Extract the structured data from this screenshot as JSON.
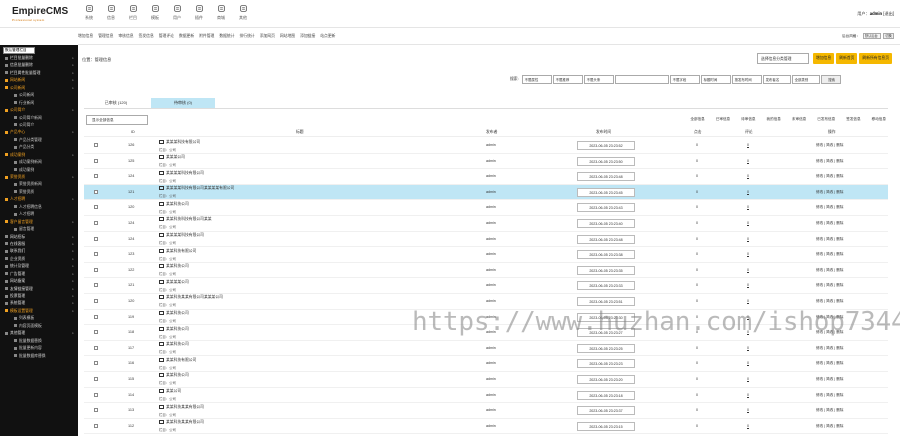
{
  "app": {
    "logo": "EmpireCMS",
    "logo_sub": "Professional system"
  },
  "topnav": [
    "系统",
    "信息",
    "栏目",
    "模板",
    "用户",
    "插件",
    "商城",
    "其他"
  ],
  "user": {
    "label": "用户：",
    "name": "admin",
    "logout": "[退出]"
  },
  "subnav": [
    "增加信息",
    "管理信息",
    "审核信息",
    "签发信息",
    "管理评论",
    "数据更新",
    "附件管理",
    "数据统计",
    "排行统计",
    "添加网页",
    "网站地图",
    "添加链接",
    "站点更新"
  ],
  "skin": {
    "label": "后台风格：",
    "select": "默认后台",
    "button": "切换"
  },
  "sidebar": {
    "select": "默认管理栏目",
    "items": [
      {
        "label": "栏目批量删除",
        "kind": "top"
      },
      {
        "label": "信息批量删除",
        "kind": "top"
      },
      {
        "label": "栏目属性批量管理",
        "kind": "top"
      },
      {
        "label": "网站新闻",
        "kind": "grp"
      },
      {
        "label": "公司新闻",
        "kind": "grp"
      },
      {
        "label": "公司新闻",
        "kind": "sub"
      },
      {
        "label": "行业新闻",
        "kind": "sub"
      },
      {
        "label": "公司简介",
        "kind": "grp"
      },
      {
        "label": "公司简介新闻",
        "kind": "sub"
      },
      {
        "label": "公司简介",
        "kind": "sub"
      },
      {
        "label": "产品中心",
        "kind": "grp"
      },
      {
        "label": "产品分类管理",
        "kind": "sub"
      },
      {
        "label": "产品分类",
        "kind": "sub"
      },
      {
        "label": "成功案例",
        "kind": "grp"
      },
      {
        "label": "成功案例新闻",
        "kind": "sub"
      },
      {
        "label": "成功案例",
        "kind": "sub"
      },
      {
        "label": "荣誉资质",
        "kind": "grp"
      },
      {
        "label": "荣誉资质新闻",
        "kind": "sub"
      },
      {
        "label": "荣誉资质",
        "kind": "sub"
      },
      {
        "label": "人才招聘",
        "kind": "grp"
      },
      {
        "label": "人才招聘信息",
        "kind": "sub"
      },
      {
        "label": "人才招聘",
        "kind": "sub"
      },
      {
        "label": "客户留言管理",
        "kind": "grp"
      },
      {
        "label": "留言管理",
        "kind": "sub"
      },
      {
        "label": "网站招标",
        "kind": "top"
      },
      {
        "label": "在线客服",
        "kind": "top"
      },
      {
        "label": "联系我们",
        "kind": "top"
      },
      {
        "label": "企业资质",
        "kind": "top"
      },
      {
        "label": "统计及管理",
        "kind": "top"
      },
      {
        "label": "广告管理",
        "kind": "top"
      },
      {
        "label": "网站备案",
        "kind": "top"
      },
      {
        "label": "友情链接管理",
        "kind": "top"
      },
      {
        "label": "投票管理",
        "kind": "top"
      },
      {
        "label": "系统管理",
        "kind": "top"
      },
      {
        "label": "模板设置管理",
        "kind": "grp"
      },
      {
        "label": "列表模板",
        "kind": "sub"
      },
      {
        "label": "内容页面模板",
        "kind": "sub"
      },
      {
        "label": "其他管理",
        "kind": "top"
      },
      {
        "label": "批量数据替换",
        "kind": "sub"
      },
      {
        "label": "批量更新内容",
        "kind": "sub"
      },
      {
        "label": "批量数据库替换",
        "kind": "sub"
      }
    ]
  },
  "location": {
    "label": "位置：",
    "value": "管理信息"
  },
  "top_actions": {
    "select": "选择信息分类管理",
    "buttons": [
      "增加信息",
      "刷新首页",
      "刷新所有信息页"
    ]
  },
  "search": {
    "label": "搜索:",
    "selects": [
      "不限属性",
      "不限推荐",
      "不限头条",
      "不限字段",
      "标题时间",
      "按发布时间",
      "发布者名",
      "全部类别"
    ],
    "button": "搜索"
  },
  "tabs": [
    {
      "label": "已审核 (120)",
      "active": false
    },
    {
      "label": "待审核 (0)",
      "active": true
    }
  ],
  "toolbar": {
    "select": "显示全部信息",
    "links": [
      "全部信息",
      "已审信息",
      "待审信息",
      "我的信息",
      "未审信息",
      "已发布信息",
      "签发信息",
      "移动信息"
    ]
  },
  "columns": {
    "id": "ID",
    "title": "标题",
    "publisher": "发布者",
    "date": "发布时间",
    "clicks": "点击",
    "comments": "评论",
    "ops": "操作"
  },
  "rows": [
    {
      "id": "126",
      "title": "某某某科技有限公司",
      "cat": "栏目：公司",
      "pub": "admin",
      "date": "2023-06-05 23:23:52",
      "c": "0",
      "m": "0"
    },
    {
      "id": "125",
      "title": "某某某公司",
      "cat": "栏目：公司",
      "pub": "admin",
      "date": "2023-06-05 23:23:50",
      "c": "0",
      "m": "0"
    },
    {
      "id": "124",
      "title": "某某某某科技有限公司",
      "cat": "栏目：公司",
      "pub": "admin",
      "date": "2023-06-05 23:23:48",
      "c": "0",
      "m": "0"
    },
    {
      "id": "121",
      "title": "某某某某科技有限公司某某某某有限公司",
      "cat": "栏目：公司",
      "pub": "admin",
      "date": "2023-06-05 23:23:45",
      "c": "0",
      "m": "0"
    },
    {
      "id": "120",
      "title": "某某科技公司",
      "cat": "栏目：公司",
      "pub": "admin",
      "date": "2023-06-05 23:23:43",
      "c": "0",
      "m": "0"
    },
    {
      "id": "124",
      "title": "某某科技科技有限公司某某",
      "cat": "栏目：公司",
      "pub": "admin",
      "date": "2023-06-05 23:23:40",
      "c": "0",
      "m": "0"
    },
    {
      "id": "124",
      "title": "某某某某科技有限公司",
      "cat": "栏目：公司",
      "pub": "admin",
      "date": "2023-06-05 23:23:48",
      "c": "0",
      "m": "0"
    },
    {
      "id": "123",
      "title": "某某科技有限公司",
      "cat": "栏目：公司",
      "pub": "admin",
      "date": "2023-06-05 23:23:38",
      "c": "0",
      "m": "0"
    },
    {
      "id": "122",
      "title": "某某科技公司",
      "cat": "栏目：公司",
      "pub": "admin",
      "date": "2023-06-05 23:23:35",
      "c": "0",
      "m": "0"
    },
    {
      "id": "121",
      "title": "某某某某公司",
      "cat": "栏目：公司",
      "pub": "admin",
      "date": "2023-06-05 23:23:33",
      "c": "0",
      "m": "0"
    },
    {
      "id": "120",
      "title": "某某科技某某有限公司某某某公司",
      "cat": "栏目：公司",
      "pub": "admin",
      "date": "2023-06-05 23:23:51",
      "c": "0",
      "m": "0"
    },
    {
      "id": "119",
      "title": "某某科技公司",
      "cat": "栏目：公司",
      "pub": "admin",
      "date": "2023-06-05 23:23:30",
      "c": "0",
      "m": "0"
    },
    {
      "id": "118",
      "title": "某某科技公司",
      "cat": "栏目：公司",
      "pub": "admin",
      "date": "2023-06-05 23:23:27",
      "c": "0",
      "m": "0"
    },
    {
      "id": "117",
      "title": "某某科技公司",
      "cat": "栏目：公司",
      "pub": "admin",
      "date": "2023-06-05 23:23:25",
      "c": "0",
      "m": "0"
    },
    {
      "id": "116",
      "title": "某某科技有限公司",
      "cat": "栏目：公司",
      "pub": "admin",
      "date": "2023-06-05 23:23:23",
      "c": "0",
      "m": "0"
    },
    {
      "id": "115",
      "title": "某某科技公司",
      "cat": "栏目：公司",
      "pub": "admin",
      "date": "2023-06-05 23:23:20",
      "c": "0",
      "m": "0"
    },
    {
      "id": "114",
      "title": "某某公司",
      "cat": "栏目：公司",
      "pub": "admin",
      "date": "2023-06-05 23:23:18",
      "c": "0",
      "m": "0"
    },
    {
      "id": "113",
      "title": "某某科技某某有限公司",
      "cat": "栏目：公司",
      "pub": "admin",
      "date": "2023-06-05 23:23:37",
      "c": "0",
      "m": "0"
    },
    {
      "id": "112",
      "title": "某某科技某某有限公司",
      "cat": "栏目：公司",
      "pub": "admin",
      "date": "2023-06-05 23:23:15",
      "c": "0",
      "m": "0"
    }
  ],
  "row_ops": "修改 | 简改 | 删除",
  "highlight_row": 3,
  "watermark": "https://www.huzhan.com/ishop7344",
  "colors": {
    "accent": "#f5b800",
    "highlight": "#bfe6f5",
    "sidebar": "#111111"
  }
}
